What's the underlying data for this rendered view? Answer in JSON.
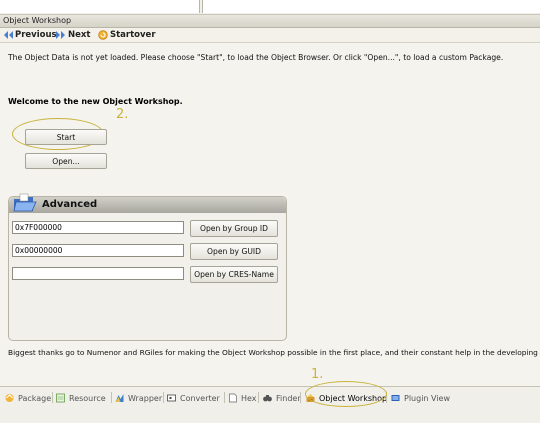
{
  "window_title": "Object Workshop",
  "nav": {
    "previous": "Previous",
    "next": "Next",
    "startover": "Startover"
  },
  "message": "The Object Data is not yet loaded. Please choose \"Start\", to load the Object Browser. Or click \"Open...\", to load a custom Package.",
  "welcome": "Welcome to the new Object Workshop.",
  "buttons": {
    "start": "Start",
    "open": "Open..."
  },
  "annotations": {
    "one": "1.",
    "two": "2."
  },
  "advanced": {
    "title": "Advanced",
    "group_id_value": "0x7F000000",
    "guid_value": "0x00000000",
    "cres_value": "",
    "open_group_id": "Open by Group ID",
    "open_guid": "Open by GUID",
    "open_cres": "Open by CRES-Name"
  },
  "thanks": "Biggest thanks go to Numenor and RGiles for making the Object Workshop possible in the first place, and their constant help in the developing p",
  "tabs": [
    {
      "label": "Package",
      "icon": "package-icon"
    },
    {
      "label": "Resource",
      "icon": "resource-icon"
    },
    {
      "label": "Wrapper",
      "icon": "wrapper-icon"
    },
    {
      "label": "Converter",
      "icon": "converter-icon"
    },
    {
      "label": "Hex",
      "icon": "hex-icon"
    },
    {
      "label": "Finder",
      "icon": "finder-icon"
    },
    {
      "label": "Object Workshop",
      "icon": "object-workshop-icon",
      "active": true
    },
    {
      "label": "Plugin View",
      "icon": "plugin-view-icon"
    }
  ],
  "colors": {
    "annotation": "#c9b33a",
    "nav_arrow": "#4a7fd0",
    "panel_header": "#a8a79f"
  }
}
